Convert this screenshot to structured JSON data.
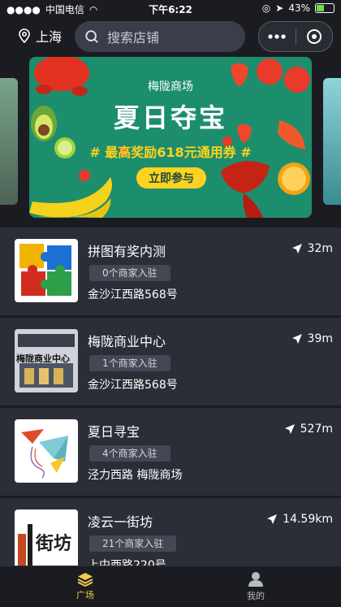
{
  "status_bar": {
    "carrier": "中国电信",
    "time": "下午6:22",
    "battery": "43%"
  },
  "top_bar": {
    "location": "上海",
    "search_placeholder": "搜索店铺",
    "icons": [
      "location-pin-icon",
      "search-icon",
      "more-icon",
      "target-icon"
    ]
  },
  "banner": {
    "subtitle": "梅陇商场",
    "title": "夏日夺宝",
    "promo": "# 最高奖励618元通用券 #",
    "cta": "立即参与",
    "colors": {
      "bg": "#1c8a6b",
      "accent": "#ffd21f"
    }
  },
  "stores": [
    {
      "name": "拼图有奖内测",
      "tag": "0个商家入驻",
      "address": "金沙江西路568号",
      "distance": "32m",
      "thumb_icon": "puzzle-icon"
    },
    {
      "name": "梅陇商业中心",
      "tag": "1个商家入驻",
      "address": "金沙江西路568号",
      "distance": "39m",
      "thumb_icon": "storefront-icon",
      "thumb_text": "梅陇商业中心"
    },
    {
      "name": "夏日寻宝",
      "tag": "4个商家入驻",
      "address": "泾力西路 梅陇商场",
      "distance": "527m",
      "thumb_icon": "paper-plane-icon"
    },
    {
      "name": "凌云一街坊",
      "tag": "21个商家入驻",
      "address": "上中西路220号",
      "distance": "14.59km",
      "thumb_icon": "logo-icon",
      "thumb_text": "街坊"
    }
  ],
  "tab_bar": {
    "tabs": [
      {
        "label": "广场",
        "icon": "layers-icon",
        "active": true
      },
      {
        "label": "我的",
        "icon": "user-icon",
        "active": false
      }
    ]
  }
}
